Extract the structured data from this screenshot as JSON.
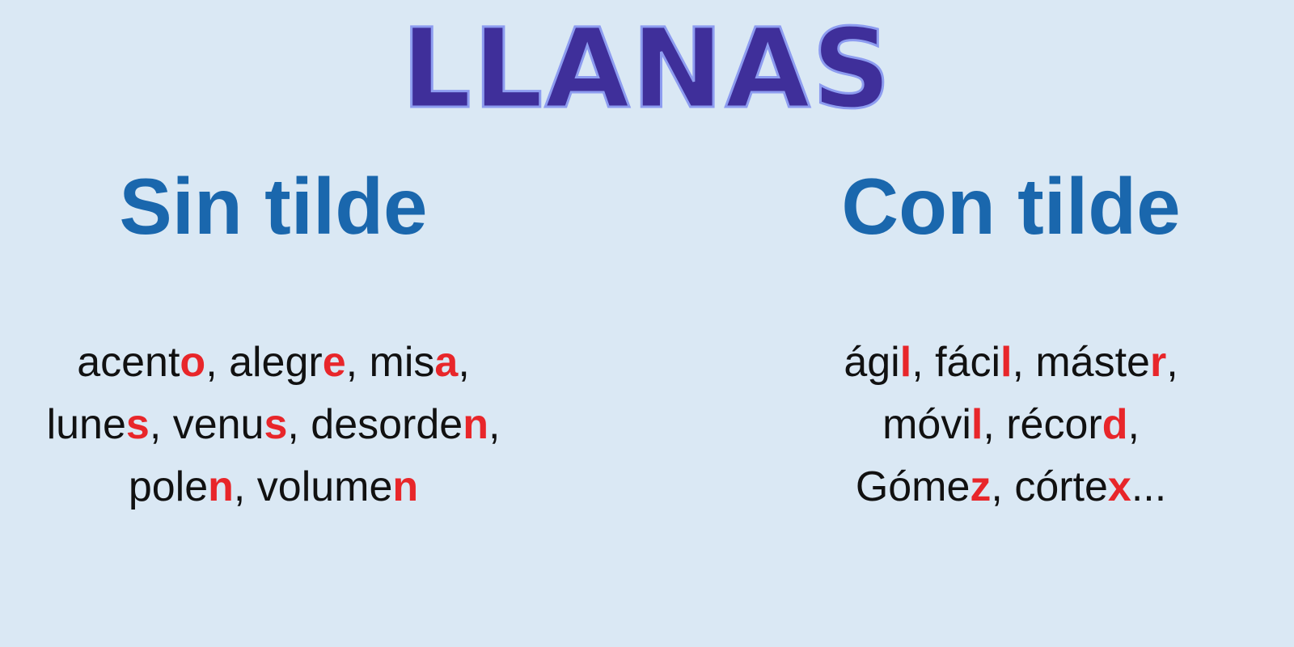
{
  "title": "LLANAS",
  "colors": {
    "background": "#dae8f4",
    "title_fill": "#3f2f9a",
    "title_outline": "#8d9cf0",
    "column_heading": "#1a67ad",
    "word_text": "#111111",
    "highlight": "#e8262a"
  },
  "columns": {
    "left": {
      "heading": "Sin tilde",
      "lines": [
        [
          {
            "text": "acent"
          },
          {
            "text": "o",
            "highlight": true
          },
          {
            "text": ", alegr"
          },
          {
            "text": "e",
            "highlight": true
          },
          {
            "text": ", mis"
          },
          {
            "text": "a",
            "highlight": true
          },
          {
            "text": ","
          }
        ],
        [
          {
            "text": "lune"
          },
          {
            "text": "s",
            "highlight": true
          },
          {
            "text": ", venu"
          },
          {
            "text": "s",
            "highlight": true
          },
          {
            "text": ", desorde"
          },
          {
            "text": "n",
            "highlight": true
          },
          {
            "text": ","
          }
        ],
        [
          {
            "text": "pole"
          },
          {
            "text": "n",
            "highlight": true
          },
          {
            "text": ", volume"
          },
          {
            "text": "n",
            "highlight": true
          }
        ]
      ]
    },
    "right": {
      "heading": "Con tilde",
      "lines": [
        [
          {
            "text": "ági"
          },
          {
            "text": "l",
            "highlight": true
          },
          {
            "text": ", fáci"
          },
          {
            "text": "l",
            "highlight": true
          },
          {
            "text": ", máste"
          },
          {
            "text": "r",
            "highlight": true
          },
          {
            "text": ","
          }
        ],
        [
          {
            "text": "móvi"
          },
          {
            "text": "l",
            "highlight": true
          },
          {
            "text": ", récor"
          },
          {
            "text": "d",
            "highlight": true
          },
          {
            "text": ","
          }
        ],
        [
          {
            "text": "Góme"
          },
          {
            "text": "z",
            "highlight": true
          },
          {
            "text": ", córte"
          },
          {
            "text": "x",
            "highlight": true
          },
          {
            "text": "..."
          }
        ]
      ]
    }
  }
}
